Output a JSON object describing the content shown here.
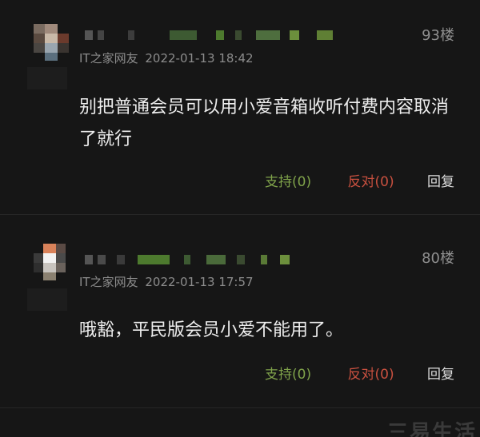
{
  "comments": [
    {
      "floor": "93楼",
      "source": "IT之家网友",
      "time": "2022-01-13 18:42",
      "text": "别把普通会员可以用小爱音箱收听付费内容取消了就行",
      "support_label": "支持(0)",
      "oppose_label": "反对(0)",
      "reply_label": "回复"
    },
    {
      "floor": "80楼",
      "source": "IT之家网友",
      "time": "2022-01-13 17:57",
      "text": "哦豁，平民版会员小爱不能用了。",
      "support_label": "支持(0)",
      "oppose_label": "反对(0)",
      "reply_label": "回复"
    }
  ],
  "watermark": "三易生活",
  "colors": {
    "background": "#161616",
    "support": "#7fa24a",
    "oppose": "#c8503f",
    "meta": "#8c8c8c"
  }
}
